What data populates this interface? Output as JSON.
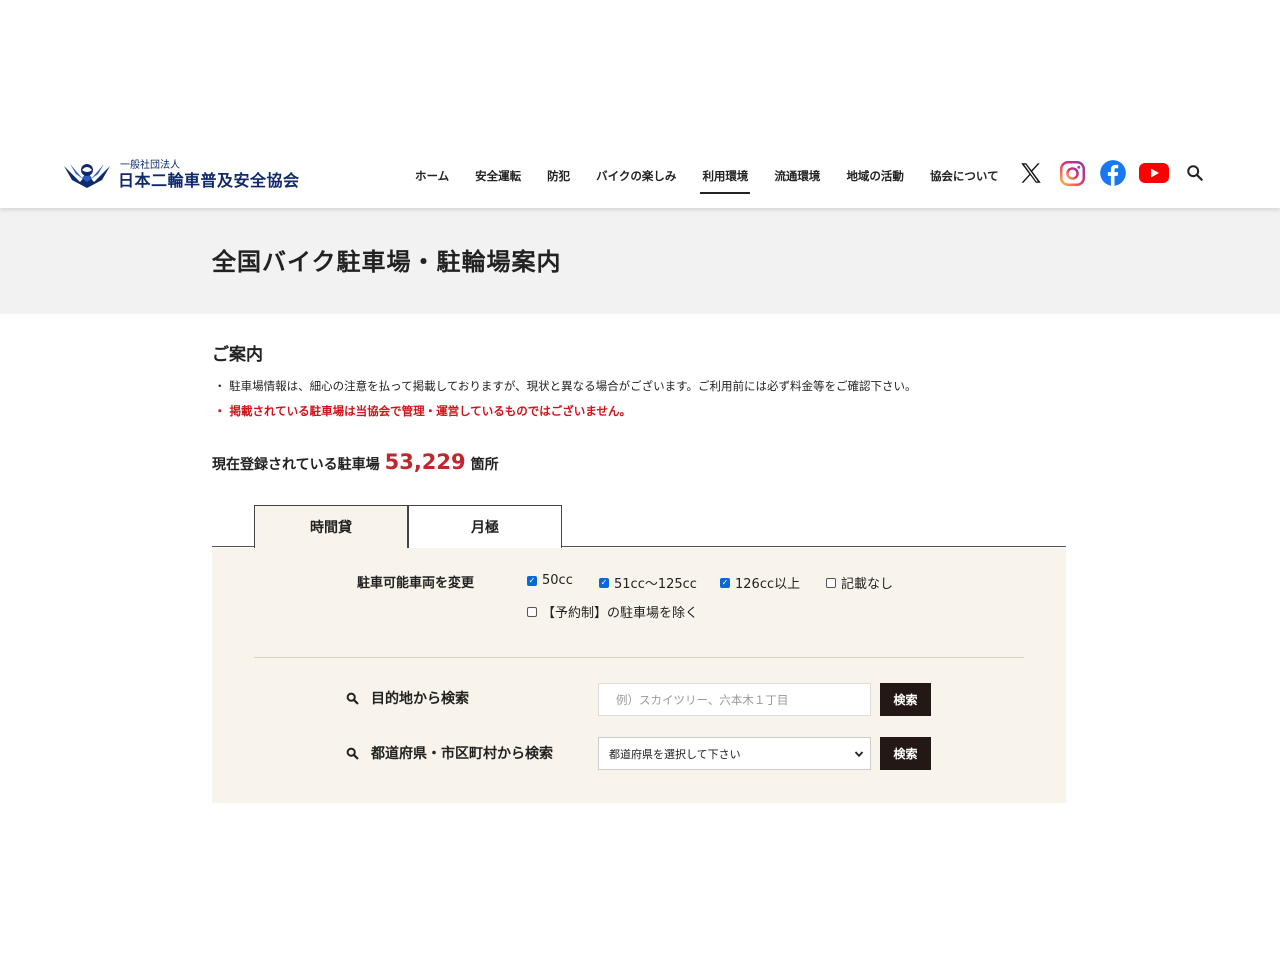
{
  "header": {
    "logo_sub": "一般社団法人",
    "logo_main": "日本二輪車普及安全協会",
    "nav": [
      "ホーム",
      "安全運転",
      "防犯",
      "バイクの楽しみ",
      "利用環境",
      "流通環境",
      "地域の活動",
      "協会について"
    ],
    "active_nav": "利用環境",
    "social_icons": [
      "x-icon",
      "instagram-icon",
      "facebook-icon",
      "youtube-icon",
      "search-icon"
    ],
    "colors": {
      "logo": "#0f2a6b",
      "instagram": "#e1306c",
      "facebook": "#1877f2",
      "youtube": "#ff0000"
    }
  },
  "page_title": "全国バイク駐車場・駐輪場案内",
  "notice": {
    "heading": "ご案内",
    "line1": "・ 駐車場情報は、細心の注意を払って掲載しておりますが、現状と異なる場合がございます。ご利用前には必ず料金等をご確認下さい。",
    "line2": "・ 掲載されている駐車場は当協会で管理・運営しているものではございません。"
  },
  "count": {
    "prefix": "現在登録されている駐車場",
    "value": "53,229",
    "suffix": "箇所"
  },
  "tabs": {
    "tab1": "時間貸",
    "tab2": "月極"
  },
  "vehicle": {
    "label": "駐車可能車両を変更",
    "options": [
      {
        "label": "50cc",
        "checked": true
      },
      {
        "label": "51cc～125cc",
        "checked": true
      },
      {
        "label": "126cc以上",
        "checked": true
      },
      {
        "label": "記載なし",
        "checked": false
      }
    ],
    "reservation_label": "【予約制】の駐車場を除く",
    "reservation_checked": false
  },
  "search": {
    "dest_label": "目的地から検索",
    "dest_placeholder": "例）スカイツリー、六本木１丁目",
    "pref_label": "都道府県・市区町村から検索",
    "pref_selected": "都道府県を選択して下さい",
    "button": "検索"
  }
}
